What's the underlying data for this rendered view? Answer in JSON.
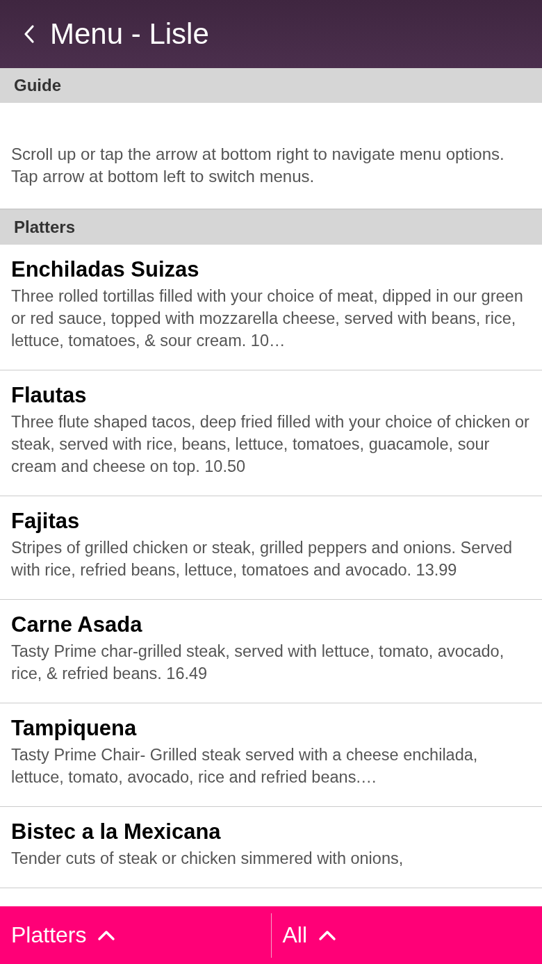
{
  "header": {
    "title": "Menu - Lisle"
  },
  "sections": [
    {
      "heading": "Guide",
      "text": "Scroll up or tap the arrow at bottom right to navigate menu options. Tap arrow at bottom left to switch menus."
    },
    {
      "heading": "Platters",
      "items": [
        {
          "name": "Enchiladas Suizas",
          "description": "Three rolled tortillas filled with your choice of meat, dipped in our green or red sauce, topped with mozzarella cheese, served with beans, rice, lettuce, tomatoes, & sour cream. 10…"
        },
        {
          "name": "Flautas",
          "description": "Three flute shaped tacos, deep fried filled with your choice of chicken or steak, served with rice, beans, lettuce, tomatoes, guacamole, sour cream and cheese on top. 10.50"
        },
        {
          "name": "Fajitas",
          "description": "Stripes of grilled chicken or steak, grilled peppers and onions. Served with rice, refried beans, lettuce, tomatoes and avocado. 13.99"
        },
        {
          "name": "Carne Asada",
          "description": "Tasty Prime char-grilled steak, served with lettuce, tomato, avocado, rice, & refried beans. 16.49"
        },
        {
          "name": "Tampiquena",
          "description": "Tasty Prime Chair- Grilled steak served with a cheese enchilada, lettuce, tomato, avocado, rice and refried beans.…"
        },
        {
          "name": "Bistec a la Mexicana",
          "description": "Tender cuts of steak or chicken simmered with onions,"
        }
      ]
    }
  ],
  "bottom_bar": [
    {
      "label": "Platters"
    },
    {
      "label": "All"
    }
  ]
}
